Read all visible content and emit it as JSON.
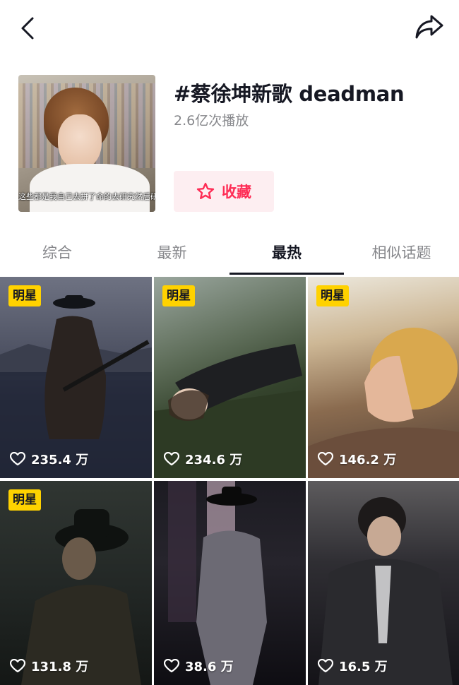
{
  "topbar": {
    "back_icon": "chevron-left-icon",
    "share_icon": "share-arrow-icon"
  },
  "topic": {
    "title": "#蔡徐坤新歌 deadman",
    "plays": "2.6亿次播放",
    "cover_subtitle": "这些都是我自己去拼了命的去研究然后研",
    "favorite_label": "收藏",
    "favorite_icon": "star-outline-icon",
    "accent_color": "#fe2c55"
  },
  "tabs": [
    {
      "label": "综合",
      "active": false
    },
    {
      "label": "最新",
      "active": false
    },
    {
      "label": "最热",
      "active": true
    },
    {
      "label": "相似话题",
      "active": false
    }
  ],
  "videos": [
    {
      "badge": "明星",
      "likes": "235.4 万"
    },
    {
      "badge": "明星",
      "likes": "234.6 万"
    },
    {
      "badge": "明星",
      "likes": "146.2 万"
    },
    {
      "badge": "明星",
      "likes": "131.8 万"
    },
    {
      "badge": "",
      "likes": "38.6 万"
    },
    {
      "badge": "",
      "likes": "16.5 万"
    }
  ],
  "colors": {
    "badge": "#ffd200",
    "text_primary": "#161823",
    "text_secondary": "#86878b"
  }
}
